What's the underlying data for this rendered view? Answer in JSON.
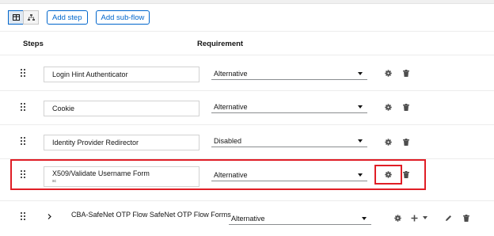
{
  "toolbar": {
    "add_step_label": "Add step",
    "add_subflow_label": "Add sub-flow"
  },
  "columns": {
    "steps": "Steps",
    "requirement": "Requirement"
  },
  "rows": [
    {
      "name": "Login Hint Authenticator",
      "requirement": "Alternative"
    },
    {
      "name": "Cookie",
      "requirement": "Alternative"
    },
    {
      "name": "Identity Provider Redirector",
      "requirement": "Disabled"
    },
    {
      "name": "X509/Validate Username Form",
      "subtext": "sc",
      "requirement": "Alternative"
    }
  ],
  "subflow": {
    "name": "CBA-SafeNet OTP Flow SafeNet OTP Flow Forms",
    "requirement": "Alternative"
  },
  "colors": {
    "primary": "#0066cc",
    "highlight": "#e01e26"
  }
}
